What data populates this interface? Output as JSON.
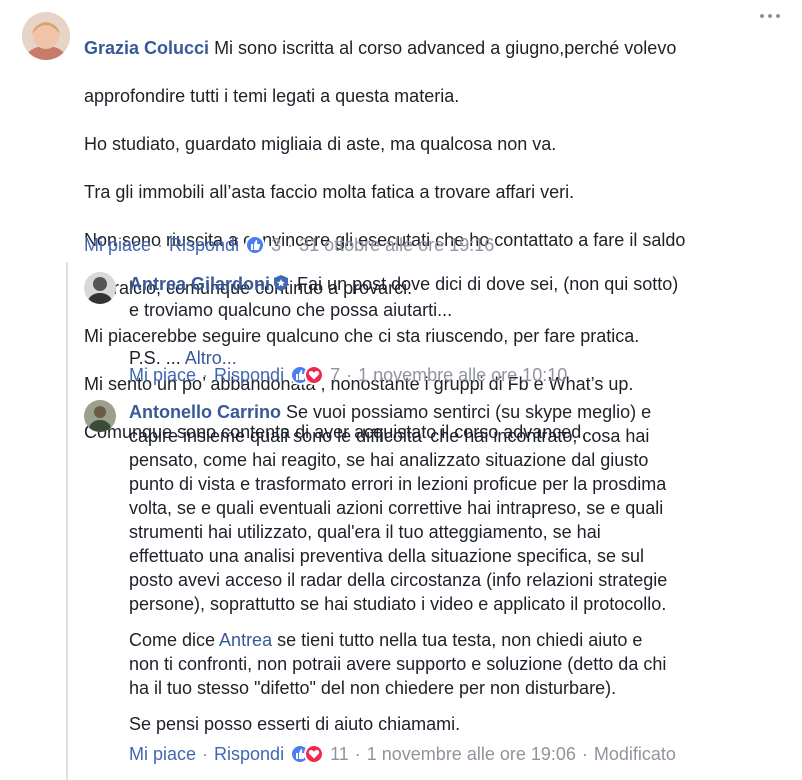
{
  "comments": [
    {
      "author": "Grazia Colucci",
      "lines": [
        "Mi sono iscritta al corso advanced a giugno,perché volevo",
        "approfondire tutti i temi legati a questa materia.",
        "Ho studiato, guardato migliaia di aste, ma qualcosa non va.",
        "Tra gli immobili all’asta faccio molta fatica a trovare affari veri.",
        "Non sono riuscita a convincere gli esecutati che ho contattato a fare il saldo",
        "e stralcio, comunque continuo a provarci.",
        "Mi piacerebbe seguire qualcuno che ci sta riuscendo, per fare pratica.",
        "Mi sento un po’ abbandonata , nonostante i gruppi di Fb e What’s up.",
        "Comunque sono contenta di aver acquistato il corso advanced."
      ],
      "like_label": "Mi piace",
      "reply_label": "Rispondi",
      "reaction_count": "3",
      "timestamp": "31 ottobre alle ore 19:16"
    },
    {
      "author": "Antrea Gilardoni",
      "text_first": "Fai un post dove dici di dove sei, (non qui sotto)",
      "text_second": "e troviamo qualcuno che possa aiutarti...",
      "ps": "P.S. ... ",
      "more_label": "Altro...",
      "like_label": "Mi piace",
      "reply_label": "Rispondi",
      "reaction_count": "7",
      "timestamp": "1 novembre alle ore 10:10"
    },
    {
      "author": "Antonello Carrino",
      "p1_first": "Se vuoi possiamo sentirci (su skype meglio) e",
      "p1_lines": [
        "capire insieme quali sono le difficolta' che hai incontrato, cosa hai",
        "pensato, come hai reagito, se hai analizzato situazione dal giusto",
        "punto di vista e trasformato errori in lezioni proficue per la prosdima",
        "volta, se e quali eventuali azioni correttive hai intrapreso, se e quali",
        "strumenti hai utilizzato, qual'era il tuo atteggiamento, se hai",
        "effettuato una analisi preventiva della situazione specifica, se sul",
        "posto avevi acceso il radar della circostanza (info relazioni strategie",
        "persone), soprattutto se hai studiato i video e applicato il protocollo."
      ],
      "p2_prefix": "Come dice ",
      "p2_mention": "Antrea",
      "p2_suffix": " se tieni tutto nella tua testa, non chiedi aiuto e",
      "p2_lines": [
        "non ti confronti, non potraii avere supporto e soluzione (detto da chi",
        "ha il tuo stesso \"difetto\" del non chiedere per non disturbare)."
      ],
      "p3": "Se pensi posso esserti di aiuto chiamami.",
      "like_label": "Mi piace",
      "reply_label": "Rispondi",
      "reaction_count": "11",
      "timestamp": "1 novembre alle ore 19:06",
      "edited_label": "Modificato"
    }
  ],
  "colors": {
    "link": "#385898",
    "meta": "#90949c",
    "like": "#4b7ef0",
    "love": "#f0284a"
  }
}
